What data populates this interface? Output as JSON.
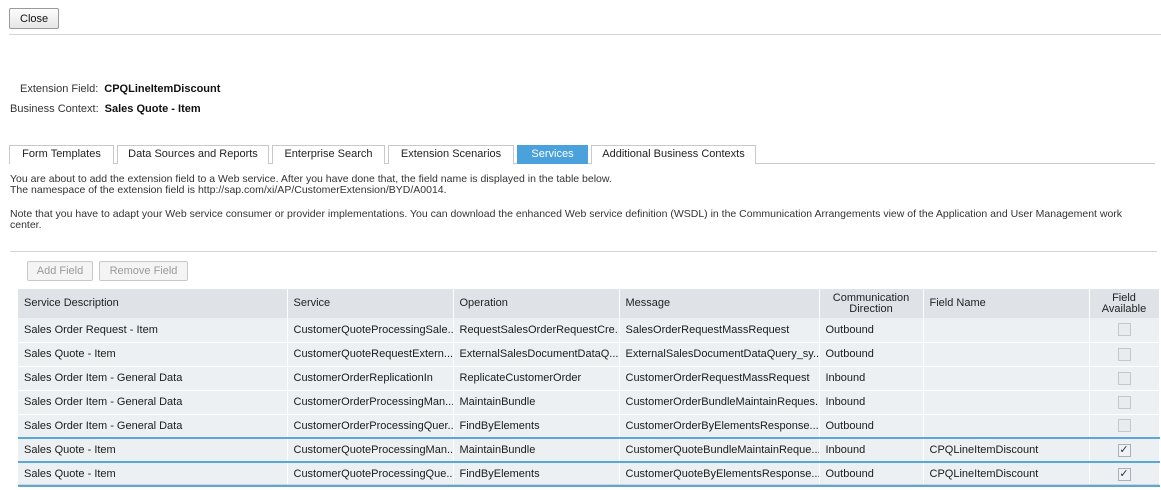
{
  "close_label": "Close",
  "extension_field": {
    "label": "Extension Field:",
    "value": "CPQLineItemDiscount"
  },
  "business_context": {
    "label": "Business Context:",
    "value": "Sales Quote - Item"
  },
  "tabs": [
    {
      "label": "Form Templates",
      "active": false
    },
    {
      "label": "Data Sources and Reports",
      "active": false
    },
    {
      "label": "Enterprise Search",
      "active": false
    },
    {
      "label": "Extension Scenarios",
      "active": false
    },
    {
      "label": "Services",
      "active": true
    },
    {
      "label": "Additional Business Contexts",
      "active": false
    }
  ],
  "info": {
    "line1": "You are about to add the extension field to a Web service. After you have done that, the field name is displayed in the table below.",
    "line2": "The namespace of the extension field is http://sap.com/xi/AP/CustomerExtension/BYD/A0014.",
    "line3": "Note that you have to adapt your Web service consumer or provider implementations. You can download the enhanced Web service definition (WSDL) in the Communication Arrangements view of the Application and User Management work center."
  },
  "toolbar": {
    "add_label": "Add Field",
    "remove_label": "Remove Field"
  },
  "table": {
    "headers": {
      "service_description": "Service Description",
      "service": "Service",
      "operation": "Operation",
      "message": "Message",
      "direction": "Communication Direction",
      "field_name": "Field Name",
      "field_available": "Field Available"
    },
    "rows": [
      {
        "desc": "Sales Order Request - Item",
        "service": "CustomerQuoteProcessingSale...",
        "operation": "RequestSalesOrderRequestCre...",
        "message": "SalesOrderRequestMassRequest",
        "direction": "Outbound",
        "field_name": "",
        "available": false
      },
      {
        "desc": "Sales Quote - Item",
        "service": "CustomerQuoteRequestExtern...",
        "operation": "ExternalSalesDocumentDataQ...",
        "message": "ExternalSalesDocumentDataQuery_sy...",
        "direction": "Outbound",
        "field_name": "",
        "available": false
      },
      {
        "desc": "Sales Order Item - General Data",
        "service": "CustomerOrderReplicationIn",
        "operation": "ReplicateCustomerOrder",
        "message": "CustomerOrderRequestMassRequest",
        "direction": "Inbound",
        "field_name": "",
        "available": false
      },
      {
        "desc": "Sales Order Item - General Data",
        "service": "CustomerOrderProcessingMan...",
        "operation": "MaintainBundle",
        "message": "CustomerOrderBundleMaintainReques...",
        "direction": "Inbound",
        "field_name": "",
        "available": false
      },
      {
        "desc": "Sales Order Item - General Data",
        "service": "CustomerOrderProcessingQuer...",
        "operation": "FindByElements",
        "message": "CustomerOrderByElementsResponse...",
        "direction": "Outbound",
        "field_name": "",
        "available": false
      },
      {
        "desc": "Sales Quote - Item",
        "service": "CustomerQuoteProcessingMan...",
        "operation": "MaintainBundle",
        "message": "CustomerQuoteBundleMaintainReque...",
        "direction": "Inbound",
        "field_name": "CPQLineItemDiscount",
        "available": true
      },
      {
        "desc": "Sales Quote - Item",
        "service": "CustomerQuoteProcessingQue...",
        "operation": "FindByElements",
        "message": "CustomerQuoteByElementsResponse...",
        "direction": "Outbound",
        "field_name": "CPQLineItemDiscount",
        "available": true
      }
    ]
  },
  "colors": {
    "active_tab": "#4aa1db",
    "header_bg": "#dfe3e7",
    "row_bg": "#edf0f2",
    "selection": "#5aa7d9"
  },
  "icons": {
    "checkbox_checked": "check-icon"
  }
}
